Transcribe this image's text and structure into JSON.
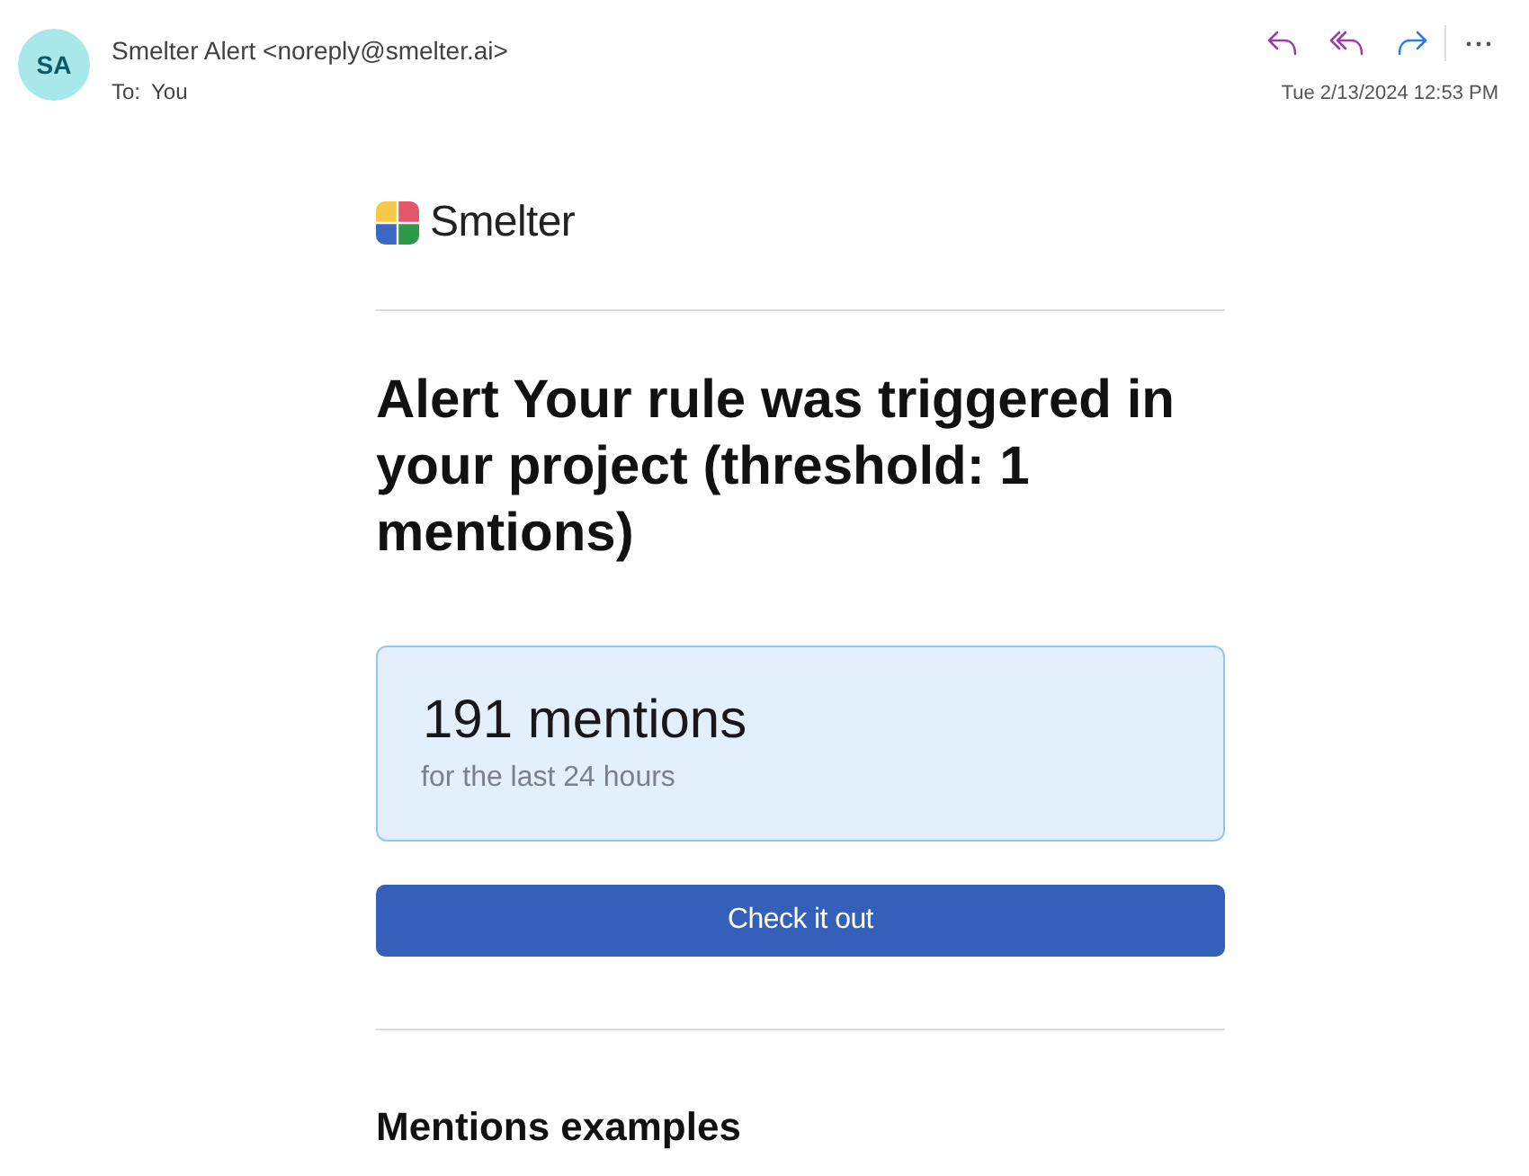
{
  "email_header": {
    "avatar_initials": "SA",
    "sender": "Smelter Alert <noreply@smelter.ai>",
    "recipient_label": "To:",
    "recipient": "You",
    "date": "Tue 2/13/2024 12:53 PM"
  },
  "body": {
    "logo_text": "Smelter",
    "heading": "Alert Your rule was triggered in your project (threshold: 1 mentions)",
    "stat": {
      "value": "191 mentions",
      "caption": "for the last 24 hours"
    },
    "button": "Check it out",
    "section_title": "Mentions examples"
  }
}
